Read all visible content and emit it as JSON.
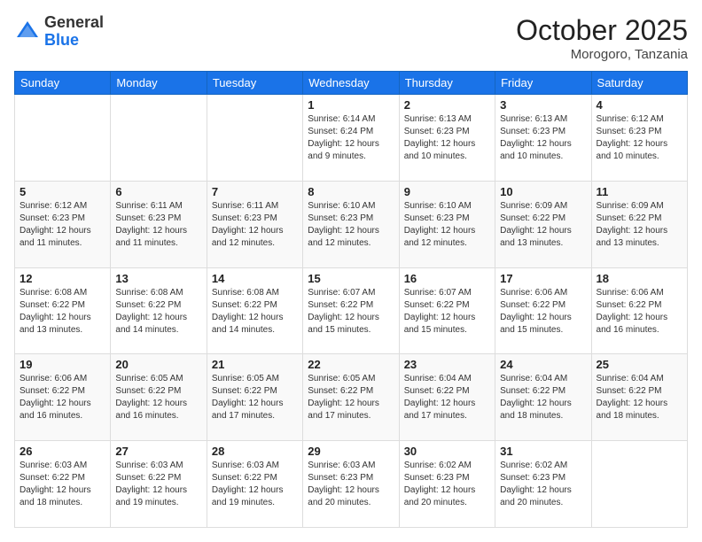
{
  "header": {
    "logo_line1": "General",
    "logo_line2": "Blue",
    "month": "October 2025",
    "location": "Morogoro, Tanzania"
  },
  "days_of_week": [
    "Sunday",
    "Monday",
    "Tuesday",
    "Wednesday",
    "Thursday",
    "Friday",
    "Saturday"
  ],
  "weeks": [
    [
      {
        "day": "",
        "info": ""
      },
      {
        "day": "",
        "info": ""
      },
      {
        "day": "",
        "info": ""
      },
      {
        "day": "1",
        "info": "Sunrise: 6:14 AM\nSunset: 6:24 PM\nDaylight: 12 hours\nand 9 minutes."
      },
      {
        "day": "2",
        "info": "Sunrise: 6:13 AM\nSunset: 6:23 PM\nDaylight: 12 hours\nand 10 minutes."
      },
      {
        "day": "3",
        "info": "Sunrise: 6:13 AM\nSunset: 6:23 PM\nDaylight: 12 hours\nand 10 minutes."
      },
      {
        "day": "4",
        "info": "Sunrise: 6:12 AM\nSunset: 6:23 PM\nDaylight: 12 hours\nand 10 minutes."
      }
    ],
    [
      {
        "day": "5",
        "info": "Sunrise: 6:12 AM\nSunset: 6:23 PM\nDaylight: 12 hours\nand 11 minutes."
      },
      {
        "day": "6",
        "info": "Sunrise: 6:11 AM\nSunset: 6:23 PM\nDaylight: 12 hours\nand 11 minutes."
      },
      {
        "day": "7",
        "info": "Sunrise: 6:11 AM\nSunset: 6:23 PM\nDaylight: 12 hours\nand 12 minutes."
      },
      {
        "day": "8",
        "info": "Sunrise: 6:10 AM\nSunset: 6:23 PM\nDaylight: 12 hours\nand 12 minutes."
      },
      {
        "day": "9",
        "info": "Sunrise: 6:10 AM\nSunset: 6:23 PM\nDaylight: 12 hours\nand 12 minutes."
      },
      {
        "day": "10",
        "info": "Sunrise: 6:09 AM\nSunset: 6:22 PM\nDaylight: 12 hours\nand 13 minutes."
      },
      {
        "day": "11",
        "info": "Sunrise: 6:09 AM\nSunset: 6:22 PM\nDaylight: 12 hours\nand 13 minutes."
      }
    ],
    [
      {
        "day": "12",
        "info": "Sunrise: 6:08 AM\nSunset: 6:22 PM\nDaylight: 12 hours\nand 13 minutes."
      },
      {
        "day": "13",
        "info": "Sunrise: 6:08 AM\nSunset: 6:22 PM\nDaylight: 12 hours\nand 14 minutes."
      },
      {
        "day": "14",
        "info": "Sunrise: 6:08 AM\nSunset: 6:22 PM\nDaylight: 12 hours\nand 14 minutes."
      },
      {
        "day": "15",
        "info": "Sunrise: 6:07 AM\nSunset: 6:22 PM\nDaylight: 12 hours\nand 15 minutes."
      },
      {
        "day": "16",
        "info": "Sunrise: 6:07 AM\nSunset: 6:22 PM\nDaylight: 12 hours\nand 15 minutes."
      },
      {
        "day": "17",
        "info": "Sunrise: 6:06 AM\nSunset: 6:22 PM\nDaylight: 12 hours\nand 15 minutes."
      },
      {
        "day": "18",
        "info": "Sunrise: 6:06 AM\nSunset: 6:22 PM\nDaylight: 12 hours\nand 16 minutes."
      }
    ],
    [
      {
        "day": "19",
        "info": "Sunrise: 6:06 AM\nSunset: 6:22 PM\nDaylight: 12 hours\nand 16 minutes."
      },
      {
        "day": "20",
        "info": "Sunrise: 6:05 AM\nSunset: 6:22 PM\nDaylight: 12 hours\nand 16 minutes."
      },
      {
        "day": "21",
        "info": "Sunrise: 6:05 AM\nSunset: 6:22 PM\nDaylight: 12 hours\nand 17 minutes."
      },
      {
        "day": "22",
        "info": "Sunrise: 6:05 AM\nSunset: 6:22 PM\nDaylight: 12 hours\nand 17 minutes."
      },
      {
        "day": "23",
        "info": "Sunrise: 6:04 AM\nSunset: 6:22 PM\nDaylight: 12 hours\nand 17 minutes."
      },
      {
        "day": "24",
        "info": "Sunrise: 6:04 AM\nSunset: 6:22 PM\nDaylight: 12 hours\nand 18 minutes."
      },
      {
        "day": "25",
        "info": "Sunrise: 6:04 AM\nSunset: 6:22 PM\nDaylight: 12 hours\nand 18 minutes."
      }
    ],
    [
      {
        "day": "26",
        "info": "Sunrise: 6:03 AM\nSunset: 6:22 PM\nDaylight: 12 hours\nand 18 minutes."
      },
      {
        "day": "27",
        "info": "Sunrise: 6:03 AM\nSunset: 6:22 PM\nDaylight: 12 hours\nand 19 minutes."
      },
      {
        "day": "28",
        "info": "Sunrise: 6:03 AM\nSunset: 6:22 PM\nDaylight: 12 hours\nand 19 minutes."
      },
      {
        "day": "29",
        "info": "Sunrise: 6:03 AM\nSunset: 6:23 PM\nDaylight: 12 hours\nand 20 minutes."
      },
      {
        "day": "30",
        "info": "Sunrise: 6:02 AM\nSunset: 6:23 PM\nDaylight: 12 hours\nand 20 minutes."
      },
      {
        "day": "31",
        "info": "Sunrise: 6:02 AM\nSunset: 6:23 PM\nDaylight: 12 hours\nand 20 minutes."
      },
      {
        "day": "",
        "info": ""
      }
    ]
  ]
}
